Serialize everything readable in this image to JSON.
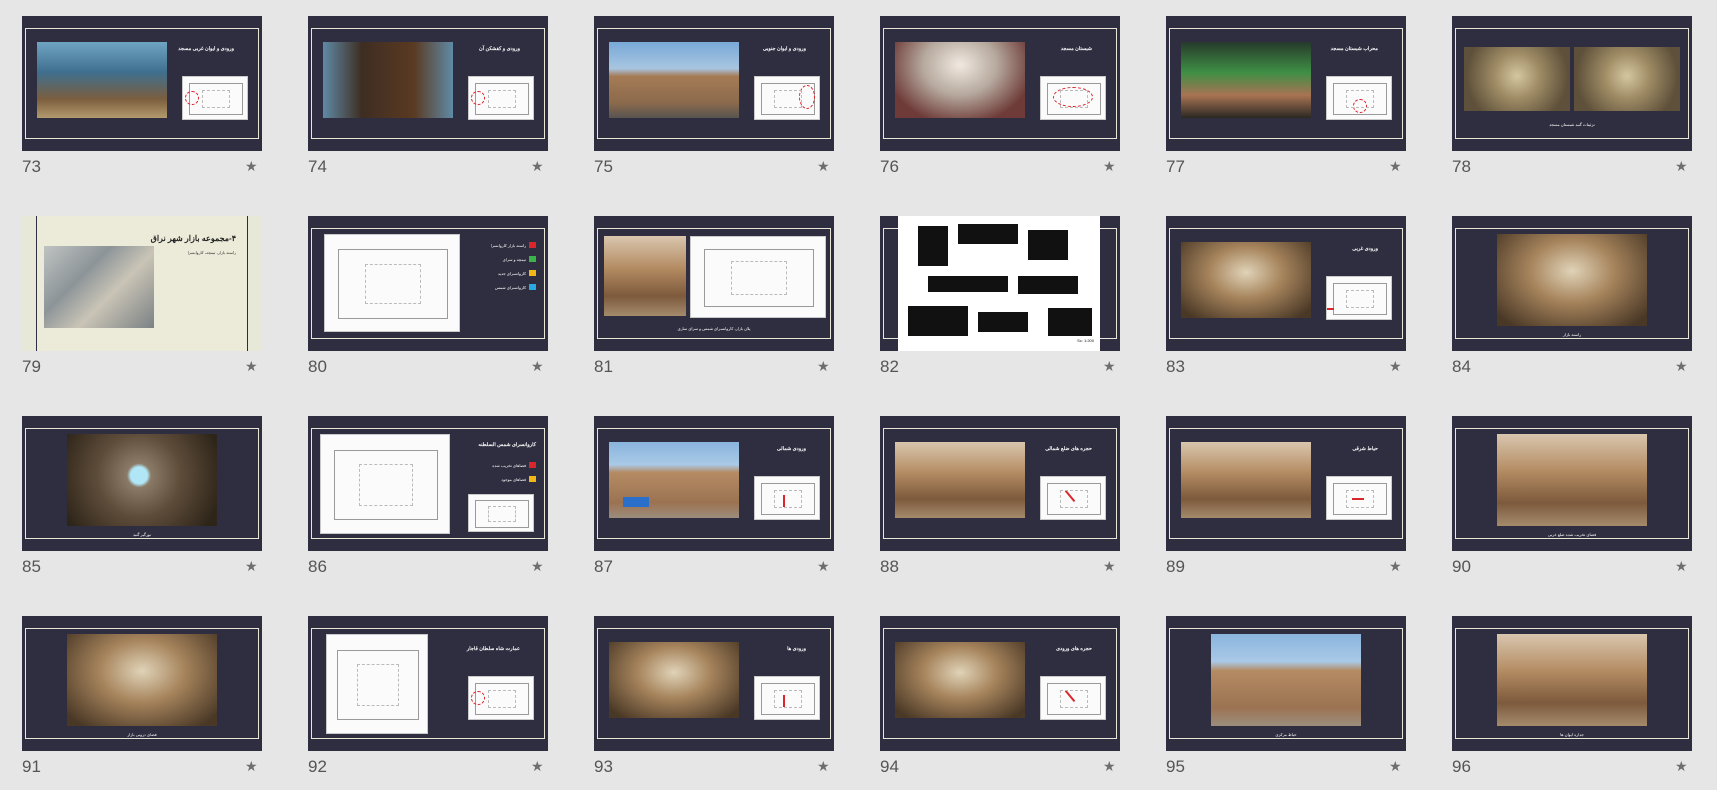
{
  "slides": [
    {
      "number": "73",
      "title": "ورودی و ایوان غربی مسجد",
      "kind": "photo-plan",
      "photo": "p-mosque",
      "marker": "ring-left"
    },
    {
      "number": "74",
      "title": "ورودی و کفشکن آن",
      "kind": "photo-plan",
      "photo": "p-door",
      "marker": "ring-left"
    },
    {
      "number": "75",
      "title": "ورودی و ایوان جنوبی",
      "kind": "photo-plan",
      "photo": "p-brick",
      "marker": "ring-right"
    },
    {
      "number": "76",
      "title": "شبستان مسجد",
      "kind": "photo-plan",
      "photo": "p-interior",
      "marker": "ring-center"
    },
    {
      "number": "77",
      "title": "محراب شبستان مسجد",
      "kind": "photo-plan",
      "photo": "p-green",
      "marker": "ring-bottom"
    },
    {
      "number": "78",
      "title": "",
      "kind": "two-photo",
      "caption": "تزئینات گنبد شبستان مسجد"
    },
    {
      "number": "79",
      "title": "۴-مجموعه بازار شهر نراق",
      "kind": "text-map",
      "caption": "راسته بازار، تیمچه، کاروانسرا"
    },
    {
      "number": "80",
      "title": "",
      "kind": "legend-plan",
      "legend": [
        "راسته بازار کاروانسرا",
        "تیمچه و سرای",
        "کاروانسرای جدید",
        "کاروانسرای شمس"
      ],
      "colors": [
        "#d9262b",
        "#3bb34a",
        "#f2b617",
        "#2aa9e0"
      ]
    },
    {
      "number": "81",
      "title": "",
      "kind": "model-plan",
      "caption": "پلان بازار، کاروانسرای شمس و سرای ساری"
    },
    {
      "number": "82",
      "title": "",
      "kind": "black-plan",
      "caption": "Sc: 1:200"
    },
    {
      "number": "83",
      "title": "ورودی غربی",
      "kind": "photo-plan",
      "photo": "p-vault",
      "marker": "arrow-left"
    },
    {
      "number": "84",
      "title": "",
      "kind": "single-photo",
      "photo": "p-vault",
      "caption": "راسته بازار"
    },
    {
      "number": "85",
      "title": "",
      "kind": "single-photo",
      "photo": "p-skylight",
      "caption": "نورگیر گنبد"
    },
    {
      "number": "86",
      "title": "کاروانسرای شمس السلطنه",
      "kind": "legend-plan2",
      "legend": [
        "فضاهای تخریب شده",
        "فضاهای موجود"
      ],
      "colors": [
        "#d9262b",
        "#f2b617"
      ]
    },
    {
      "number": "87",
      "title": "ورودی شمالی",
      "kind": "photo-plan",
      "photo": "p-court",
      "marker": "arrow-down",
      "car": true
    },
    {
      "number": "88",
      "title": "حجره های ضلع شمالی",
      "kind": "photo-plan",
      "photo": "p-arches",
      "marker": "arrow-diag"
    },
    {
      "number": "89",
      "title": "حیاط شرقی",
      "kind": "photo-plan",
      "photo": "p-arches",
      "marker": "arrow-right"
    },
    {
      "number": "90",
      "title": "",
      "kind": "single-photo",
      "photo": "p-arches",
      "caption": "فضای تخریب شده ضلع غربی"
    },
    {
      "number": "91",
      "title": "",
      "kind": "single-photo",
      "photo": "p-vault",
      "caption": "فضای درونی بازار"
    },
    {
      "number": "92",
      "title": "عمارت شاه سلطان قاجار",
      "kind": "plan-only",
      "marker": "ring-left"
    },
    {
      "number": "93",
      "title": "ورودی ها",
      "kind": "photo-plan",
      "photo": "p-vault",
      "marker": "arrow-down"
    },
    {
      "number": "94",
      "title": "حجره های ورودی",
      "kind": "photo-plan",
      "photo": "p-vault",
      "marker": "arrow-diag"
    },
    {
      "number": "95",
      "title": "",
      "kind": "single-photo",
      "photo": "p-court",
      "caption": "حیاط مرکزی"
    },
    {
      "number": "96",
      "title": "",
      "kind": "single-photo",
      "photo": "p-arches",
      "caption": "جداره ایوان ها"
    }
  ]
}
